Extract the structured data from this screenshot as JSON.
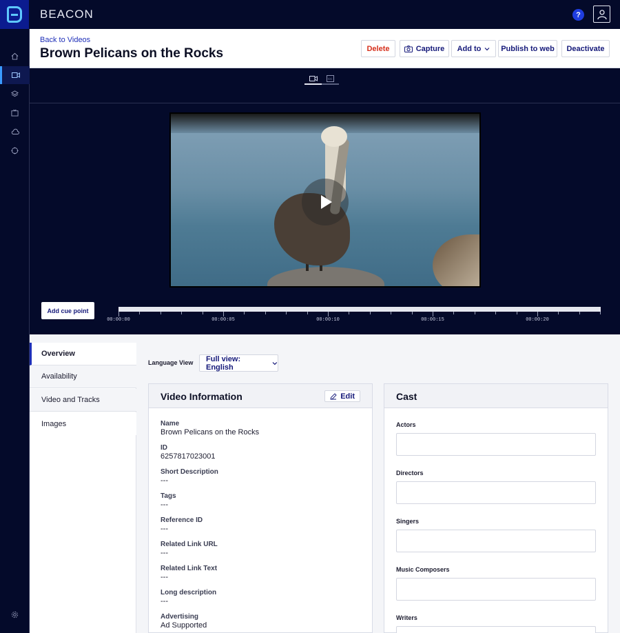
{
  "app": {
    "brand": "BEACON"
  },
  "topbar": {
    "help_label": "?"
  },
  "sidebar": {
    "items": [
      {
        "icon": "home-icon"
      },
      {
        "icon": "video-camera-icon",
        "active": true
      },
      {
        "icon": "layers-icon"
      },
      {
        "icon": "tv-icon"
      },
      {
        "icon": "cloud-icon"
      },
      {
        "icon": "compass-icon"
      }
    ],
    "bottom_icon": "gear-icon"
  },
  "header": {
    "back_link": "Back to Videos",
    "title": "Brown Pelicans on the Rocks",
    "buttons": {
      "delete": "Delete",
      "capture": "Capture",
      "add_to": "Add to",
      "publish": "Publish to web",
      "deactivate": "Deactivate"
    }
  },
  "player": {
    "tabs": [
      {
        "icon": "video-camera-icon",
        "active": true
      },
      {
        "icon": "closed-captions-icon",
        "active": false
      }
    ],
    "cue_button": "Add cue point",
    "timeline_labels": [
      "00:00:00",
      "00:00:05",
      "00:00:10",
      "00:00:15",
      "00:00:20"
    ],
    "accent": "#3a9bff"
  },
  "details_nav": {
    "items": [
      {
        "label": "Overview",
        "active": true
      },
      {
        "label": "Availability"
      },
      {
        "label": "Video and Tracks"
      },
      {
        "label": "Images"
      }
    ]
  },
  "language": {
    "label": "Language View",
    "selected": "Full view: English"
  },
  "video_info": {
    "title": "Video Information",
    "edit_label": "Edit",
    "fields": [
      {
        "label": "Name",
        "value": "Brown Pelicans on the Rocks"
      },
      {
        "label": "ID",
        "value": "6257817023001"
      },
      {
        "label": "Short Description",
        "value": "---"
      },
      {
        "label": "Tags",
        "value": "---"
      },
      {
        "label": "Reference ID",
        "value": "---"
      },
      {
        "label": "Related Link URL",
        "value": "---"
      },
      {
        "label": "Related Link Text",
        "value": "---"
      },
      {
        "label": "Long description",
        "value": "---"
      },
      {
        "label": "Advertising",
        "value": "Ad Supported"
      }
    ]
  },
  "cast": {
    "title": "Cast",
    "groups": [
      {
        "label": "Actors"
      },
      {
        "label": "Directors"
      },
      {
        "label": "Singers"
      },
      {
        "label": "Music Composers"
      },
      {
        "label": "Writers"
      }
    ]
  },
  "colors": {
    "navy": "#040a2a",
    "link_blue": "#1e2fb8",
    "button_text": "#15197a",
    "delete_red": "#d6301c"
  }
}
